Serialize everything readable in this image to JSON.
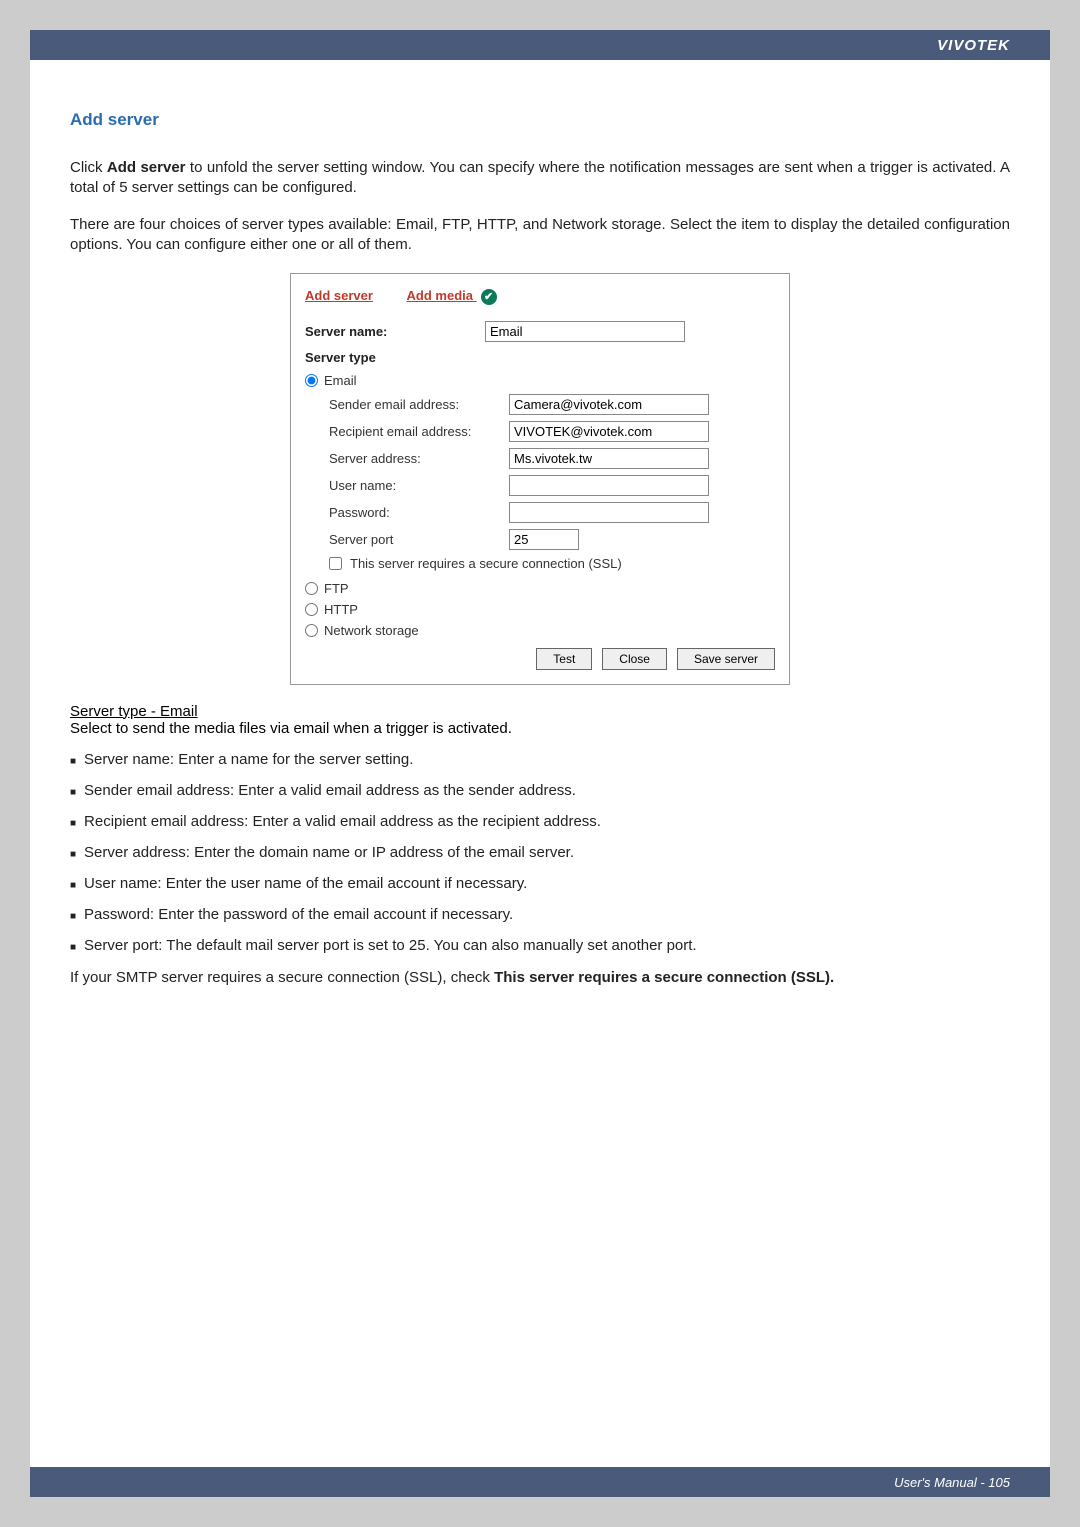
{
  "header": {
    "brand": "VIVOTEK"
  },
  "section": {
    "title": "Add server"
  },
  "intro": {
    "p1a": "Click ",
    "p1b": "Add server",
    "p1c": " to unfold the server setting window. You can specify where the notification messages are sent when a trigger is activated. A total of 5 server settings can be configured.",
    "p2": "There are four choices of server types available: Email, FTP, HTTP, and Network storage. Select the item to display the detailed configuration options. You can configure either one or all of them."
  },
  "dialog": {
    "links": {
      "add_server": "Add server",
      "add_media": "Add media"
    },
    "server_name_label": "Server name:",
    "server_name_value": "Email",
    "server_type_label": "Server type",
    "radios": {
      "email": "Email",
      "ftp": "FTP",
      "http": "HTTP",
      "network_storage": "Network storage"
    },
    "email_fields": {
      "sender_label": "Sender email address:",
      "sender_value": "Camera@vivotek.com",
      "recipient_label": "Recipient email address:",
      "recipient_value": "VIVOTEK@vivotek.com",
      "server_address_label": "Server address:",
      "server_address_value": "Ms.vivotek.tw",
      "username_label": "User name:",
      "username_value": "",
      "password_label": "Password:",
      "password_value": "",
      "port_label": "Server port",
      "port_value": "25",
      "ssl_label": "This server requires a secure connection (SSL)"
    },
    "buttons": {
      "test": "Test",
      "close": "Close",
      "save": "Save server"
    }
  },
  "body": {
    "subheading": "Server type - Email",
    "subtext": "Select to send the media files via email when a trigger is activated.",
    "bullets": [
      "Server name: Enter a name for the server setting.",
      "Sender email address: Enter a valid email address as the sender address.",
      "Recipient email address: Enter a valid email address as the recipient address.",
      "Server address: Enter the domain name or IP address of the email server.",
      "User name: Enter the user name of the email account if necessary.",
      "Password: Enter the password of the email account if necessary.",
      "Server port: The default mail server port is set to 25. You can also manually set another port."
    ],
    "ssl_note_a": "If your SMTP server requires a secure connection (SSL), check ",
    "ssl_note_b": "This server requires a secure connection (SSL)."
  },
  "footer": {
    "text": "User's Manual - 105"
  }
}
